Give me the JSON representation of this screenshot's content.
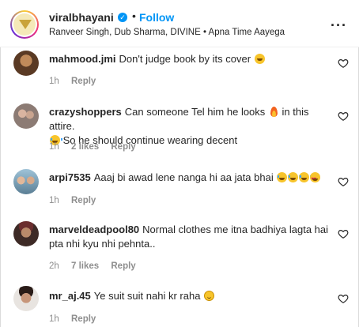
{
  "header": {
    "username": "viralbhayani",
    "verified": true,
    "separator": "•",
    "follow_label": "Follow",
    "subtitle": "Ranveer Singh, Dub Sharma, DIVINE • Apna Time Aayega",
    "more_icon": "more-horizontal-icon",
    "more_glyph": "···"
  },
  "comments": [
    {
      "username": "mahmood.jmi",
      "text": "Don't judge book by its cover",
      "emojis": [
        "grinning-squint-face"
      ],
      "time": "1h",
      "likes": "",
      "reply_label": "Reply"
    },
    {
      "username": "crazyshoppers",
      "text": "Can someone Tel him he looks",
      "emojis_inline": [
        "fire"
      ],
      "text_after": "in this attire.",
      "text_line2": "So he should continue wearing decent",
      "emojis_line2_prefix": [
        "face-with-tears-of-joy"
      ],
      "time": "1h",
      "likes": "2 likes",
      "reply_label": "Reply"
    },
    {
      "username": "arpi7535",
      "text": "Aaaj bi awad lene nanga hi aa jata bhai",
      "emojis": [
        "face-with-tears-of-joy",
        "face-with-tears-of-joy",
        "face-with-tears-of-joy",
        "smiling-face-with-heart-eyes"
      ],
      "time": "1h",
      "likes": "",
      "reply_label": "Reply"
    },
    {
      "username": "marveldeadpool80",
      "text": "Normal clothes me itna badhiya lagta hai pta nhi kyu nhi pehnta..",
      "time": "2h",
      "likes": "7 likes",
      "reply_label": "Reply"
    },
    {
      "username": "mr_aj.45",
      "text": "Ye suit suit nahi kr raha",
      "emojis": [
        "slightly-smiling-face"
      ],
      "time": "1h",
      "likes": "",
      "reply_label": "Reply"
    }
  ],
  "icons": {
    "like": "heart-outline-icon",
    "verified": "verified-badge-icon"
  },
  "colors": {
    "link_blue": "#0095f6",
    "text": "#262626",
    "meta_grey": "#8e8e8e"
  }
}
